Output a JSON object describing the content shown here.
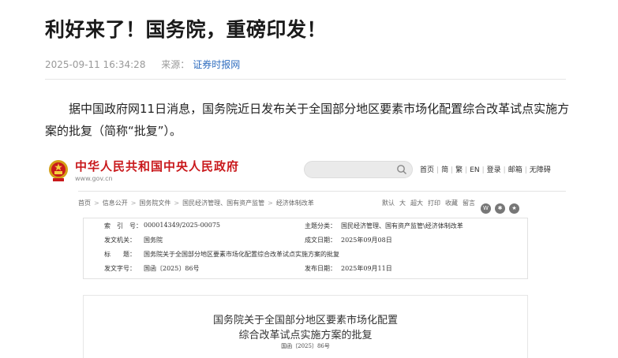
{
  "article": {
    "title": "利好来了！国务院，重磅印发！",
    "datetime": "2025-09-11 16:34:28",
    "source_label": "来源：",
    "source_name": "证券时报网",
    "lead": "据中国政府网11日消息，国务院近日发布关于全国部分地区要素市场化配置综合改革试点实施方案的批复（简称“批复”）。"
  },
  "gov_site": {
    "name": "中华人民共和国中央人民政府",
    "url": "www.gov.cn",
    "nav": [
      "首页",
      "简",
      "繁",
      "EN",
      "登录",
      "邮箱",
      "无障碍"
    ],
    "breadcrumbs": [
      "首页",
      "信息公开",
      "国务院文件",
      "国民经济管理、国有资产监管",
      "经济体制改革"
    ],
    "tools": [
      "默认",
      "大",
      "超大",
      "打印",
      "收藏",
      "留言"
    ],
    "share_icons": [
      "weibo-icon",
      "wechat-icon",
      "qzone-icon"
    ]
  },
  "doc_info": {
    "rows": [
      {
        "k1": "索　引　号：",
        "v1": "000014349/2025-00075",
        "k2": "主题分类：",
        "v2": "国民经济管理、国有资产监管\\经济体制改革"
      },
      {
        "k1": "发文机关：",
        "v1": "国务院",
        "k2": "成文日期：",
        "v2": "2025年09月08日"
      },
      {
        "k1": "标　　题：",
        "v1": "国务院关于全国部分地区要素市场化配置综合改革试点实施方案的批复",
        "k2": "",
        "v2": ""
      },
      {
        "k1": "发文字号：",
        "v1": "国函〔2025〕86号",
        "k2": "发布日期：",
        "v2": "2025年09月11日"
      }
    ]
  },
  "document": {
    "title_line1": "国务院关于全国部分地区要素市场化配置",
    "title_line2": "综合改革试点实施方案的批复",
    "doc_number": "国函〔2025〕86号"
  },
  "colors": {
    "gov_red": "#c9191c",
    "link_blue": "#2f6dbf"
  }
}
